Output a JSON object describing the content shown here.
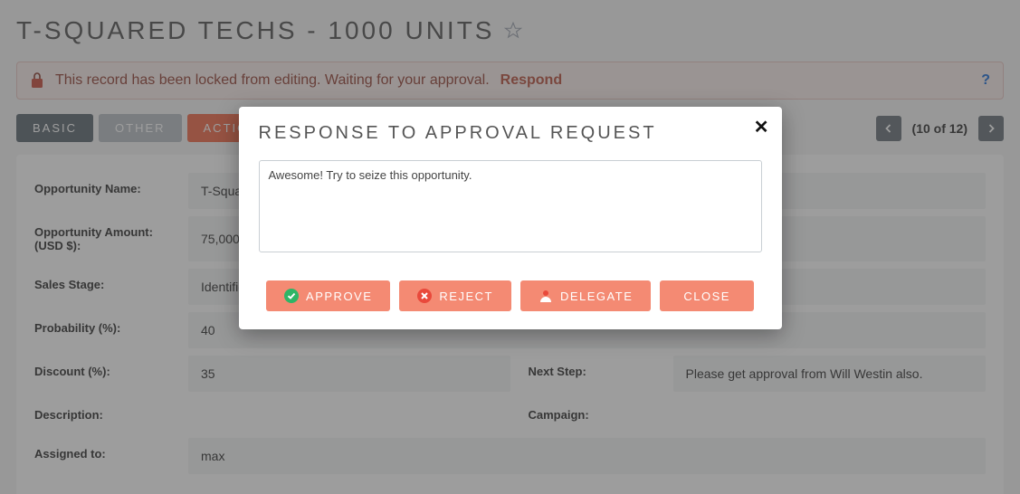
{
  "page": {
    "title": "T-SQUARED TECHS - 1000 UNITS"
  },
  "alert": {
    "message": "This record has been locked from editing. Waiting for your approval.",
    "respond_label": "Respond"
  },
  "tabs": {
    "basic": "BASIC",
    "other": "OTHER",
    "actions": "ACTIONS"
  },
  "pager": {
    "text": "(10 of 12)"
  },
  "fields": {
    "opportunity_name": {
      "label": "Opportunity Name:",
      "value": "T-Squared"
    },
    "opportunity_amount": {
      "label": "Opportunity Amount: (USD $):",
      "value": "75,000"
    },
    "sales_stage": {
      "label": "Sales Stage:",
      "value": "Identified"
    },
    "probability": {
      "label": "Probability (%):",
      "value": "40"
    },
    "discount": {
      "label": "Discount (%):",
      "value": "35"
    },
    "description": {
      "label": "Description:",
      "value": ""
    },
    "assigned_to": {
      "label": "Assigned to:",
      "value": "max"
    },
    "next_step": {
      "label": "Next Step:",
      "value": "Please get approval from Will Westin also."
    },
    "campaign": {
      "label": "Campaign:",
      "value": ""
    }
  },
  "modal": {
    "title": "RESPONSE TO APPROVAL REQUEST",
    "textarea_value": "Awesome! Try to seize this opportunity.",
    "buttons": {
      "approve": "APPROVE",
      "reject": "REJECT",
      "delegate": "DELEGATE",
      "close": "CLOSE"
    }
  }
}
